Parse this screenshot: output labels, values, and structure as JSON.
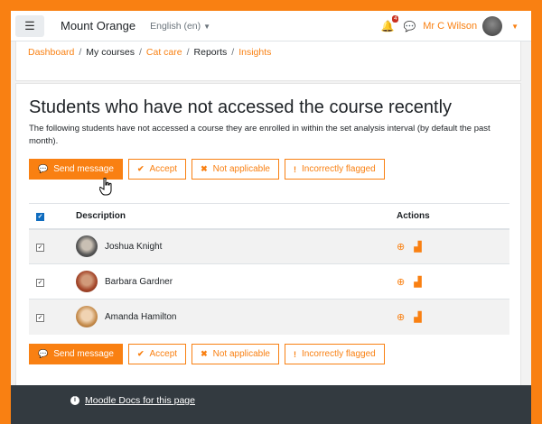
{
  "navbar": {
    "menu_icon": "hamburger-icon",
    "site_name": "Mount Orange",
    "language": "English (en)",
    "notification_count": "4",
    "user_name": "Mr C Wilson"
  },
  "breadcrumb": {
    "items": [
      "Dashboard",
      "My courses",
      "Cat care",
      "Reports",
      "Insights"
    ],
    "separator": "/"
  },
  "main": {
    "title": "Students who have not accessed the course recently",
    "description": "The following students have not accessed a course they are enrolled in within the set analysis interval (by default the past month).",
    "buttons": {
      "send": "Send message",
      "accept": "Accept",
      "not_applicable": "Not applicable",
      "incorrect": "Incorrectly flagged"
    },
    "table": {
      "headers": {
        "description": "Description",
        "actions": "Actions"
      },
      "rows": [
        {
          "name": "Joshua Knight",
          "checked": true
        },
        {
          "name": "Barbara Gardner",
          "checked": true
        },
        {
          "name": "Amanda Hamilton",
          "checked": true
        }
      ]
    }
  },
  "footer": {
    "docs_link": "Moodle Docs for this page"
  },
  "colors": {
    "accent": "#f98012",
    "footer_bg": "#333a40"
  }
}
